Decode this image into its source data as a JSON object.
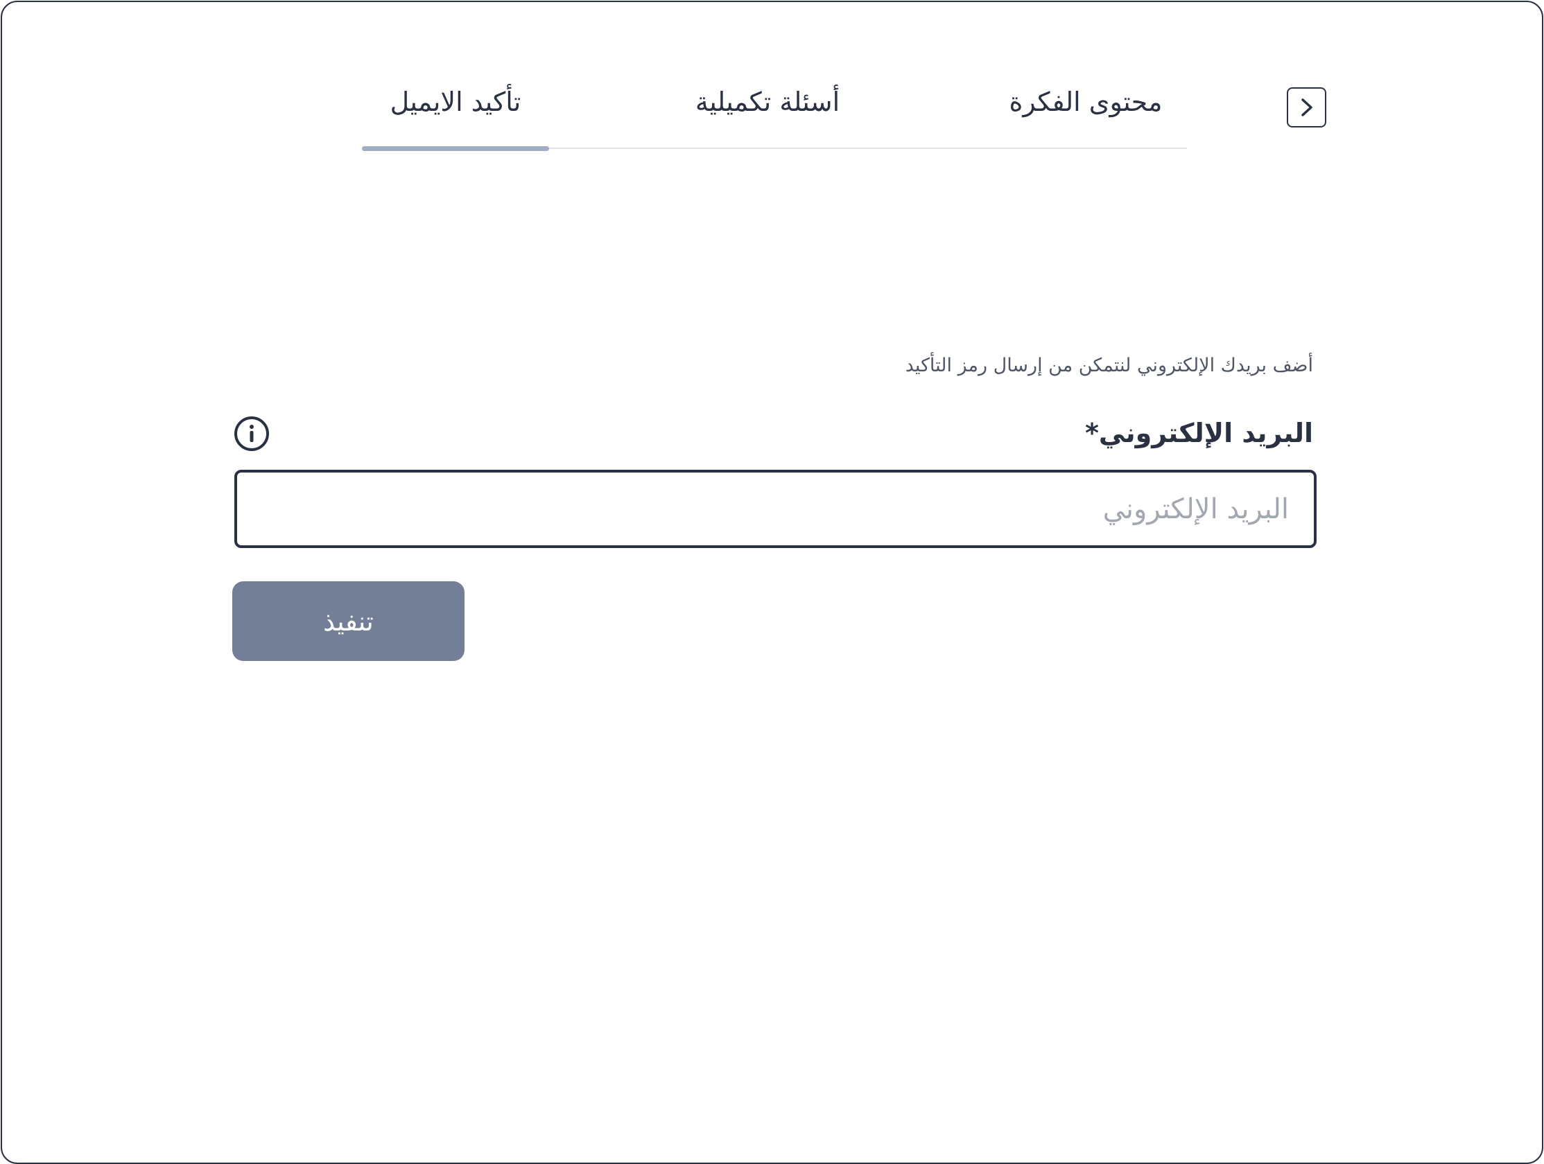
{
  "nav": {
    "back_icon": "chevron-right-icon"
  },
  "tabs": [
    {
      "label": "محتوى الفكرة",
      "active": false
    },
    {
      "label": "أسئلة تكميلية",
      "active": false
    },
    {
      "label": "تأكيد الايميل",
      "active": true
    }
  ],
  "form": {
    "helper_text": "أضف بريدك الإلكتروني لنتمكن من إرسال رمز التأكيد",
    "email_label": "البريد الإلكتروني*",
    "email_placeholder": "البريد الإلكتروني",
    "email_value": "",
    "info_icon": "info-icon",
    "submit_label": "تنفيذ"
  },
  "colors": {
    "text": "#2a3142",
    "active_tab_indicator": "#a0adc3",
    "button_bg": "#737f97",
    "placeholder": "#a3a7af"
  }
}
